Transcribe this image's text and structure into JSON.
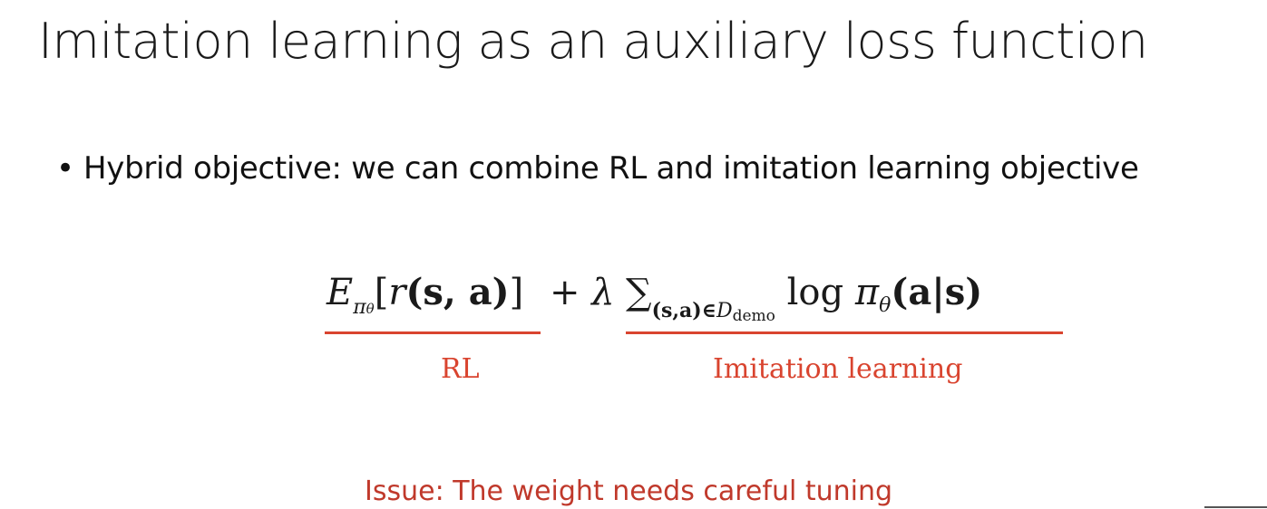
{
  "slide": {
    "title": "Imitation learning as an auxiliary loss function",
    "bullet": {
      "symbol": "•",
      "text": "Hybrid objective: we can combine RL and imitation learning objective"
    },
    "equation": {
      "rl_term": {
        "E": "E",
        "pi_sub": "π",
        "theta_sub": "θ",
        "open": "[",
        "r": "r",
        "args": "(s, a)",
        "close": "]"
      },
      "plus": "+",
      "lambda": "λ",
      "sum": "∑",
      "sum_sub": "(s,a)∈",
      "D": "D",
      "demo": "demo",
      "log": "log",
      "pi": "π",
      "theta": "θ",
      "policy_args": "(a|s)"
    },
    "labels": {
      "rl": "RL",
      "imitation": "Imitation learning"
    },
    "issue": "Issue: The weight needs careful tuning",
    "colors": {
      "accent": "#d9442f",
      "issue": "#c0392b",
      "text": "#1a1a1a"
    }
  }
}
